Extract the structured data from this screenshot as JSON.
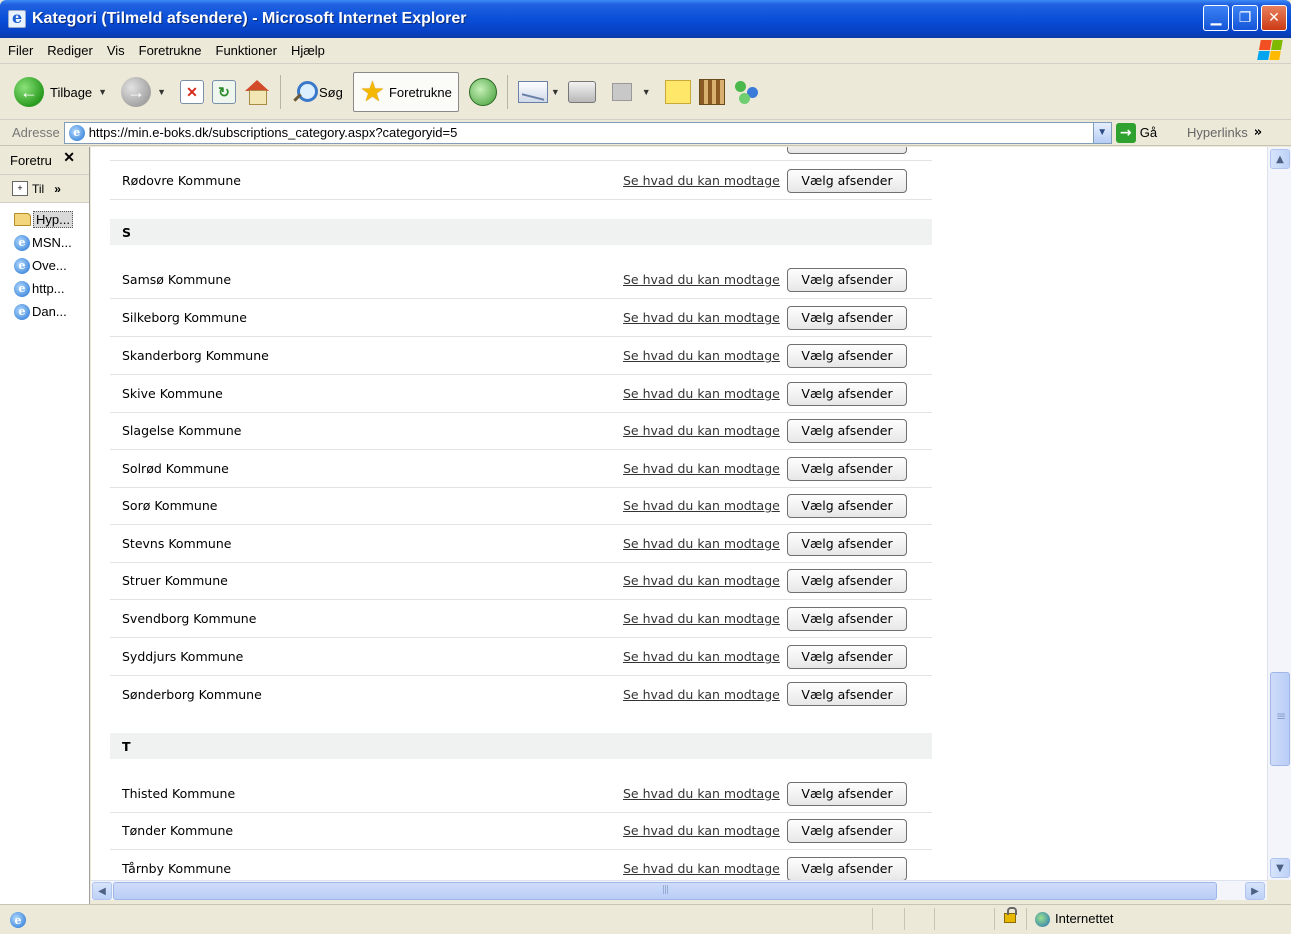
{
  "window": {
    "title": "Kategori (Tilmeld afsendere) - Microsoft Internet Explorer"
  },
  "menu": [
    "Filer",
    "Rediger",
    "Vis",
    "Foretrukne",
    "Funktioner",
    "Hjælp"
  ],
  "toolbar": {
    "back": "Tilbage",
    "search": "Søg",
    "favorites": "Foretrukne"
  },
  "address": {
    "label": "Adresse",
    "url": "https://min.e-boks.dk/subscriptions_category.aspx?categoryid=5",
    "go": "Gå",
    "links": "Hyperlinks"
  },
  "favorites_pane": {
    "title": "Foretru",
    "add_label": "Til",
    "items": [
      "Hyp...",
      "MSN...",
      "Ove...",
      "http...",
      "Dan..."
    ]
  },
  "list": {
    "link_label": "Se hvad du kan modtage",
    "button_label": "Vælg afsender",
    "top_entry": "Rødovre Kommune",
    "group_s": "S",
    "s_entries": [
      "Samsø Kommune",
      "Silkeborg Kommune",
      "Skanderborg Kommune",
      "Skive Kommune",
      "Slagelse Kommune",
      "Solrød Kommune",
      "Sorø Kommune",
      "Stevns Kommune",
      "Struer Kommune",
      "Svendborg Kommune",
      "Syddjurs Kommune",
      "Sønderborg Kommune"
    ],
    "group_t": "T",
    "t_entries": [
      "Thisted Kommune",
      "Tønder Kommune",
      "Tårnby Kommune"
    ]
  },
  "status": {
    "zone": "Internettet"
  },
  "colors": {
    "titlebar": "#0a4fd8",
    "chrome": "#ece9d8",
    "letter_band": "#f0f2f2"
  }
}
